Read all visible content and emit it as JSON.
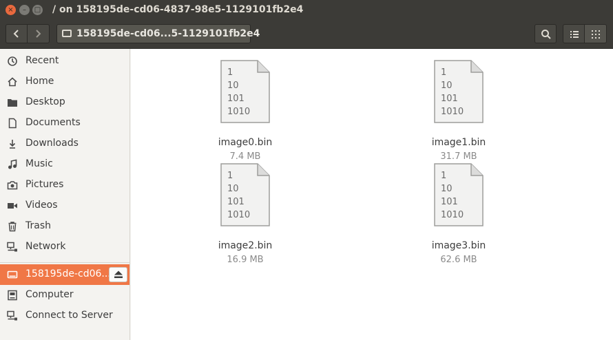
{
  "window": {
    "title": "/ on 158195de-cd06-4837-98e5-1129101fb2e4",
    "close_glyph": "×",
    "min_glyph": "–",
    "max_glyph": "□"
  },
  "toolbar": {
    "path_label": "158195de-cd06...5-1129101fb2e4"
  },
  "sidebar": {
    "items": [
      {
        "label": "Recent",
        "icon": "clock-icon"
      },
      {
        "label": "Home",
        "icon": "home-icon"
      },
      {
        "label": "Desktop",
        "icon": "folder-icon"
      },
      {
        "label": "Documents",
        "icon": "document-icon"
      },
      {
        "label": "Downloads",
        "icon": "download-icon"
      },
      {
        "label": "Music",
        "icon": "music-icon"
      },
      {
        "label": "Pictures",
        "icon": "camera-icon"
      },
      {
        "label": "Videos",
        "icon": "video-icon"
      },
      {
        "label": "Trash",
        "icon": "trash-icon"
      },
      {
        "label": "Network",
        "icon": "network-icon"
      }
    ],
    "devices": [
      {
        "label": "158195de-cd06...",
        "icon": "drive-icon",
        "active": true
      },
      {
        "label": "Computer",
        "icon": "computer-icon"
      },
      {
        "label": "Connect to Server",
        "icon": "server-icon"
      }
    ]
  },
  "files": [
    {
      "name": "image0.bin",
      "size": "7.4 MB"
    },
    {
      "name": "image1.bin",
      "size": "31.7 MB"
    },
    {
      "name": "image2.bin",
      "size": "16.9 MB"
    },
    {
      "name": "image3.bin",
      "size": "62.6 MB"
    }
  ],
  "binary_lines": [
    "1",
    "10",
    "101",
    "1010"
  ],
  "colors": {
    "accent": "#f07746",
    "titlebar": "#3c3b37",
    "close": "#e9693e"
  }
}
